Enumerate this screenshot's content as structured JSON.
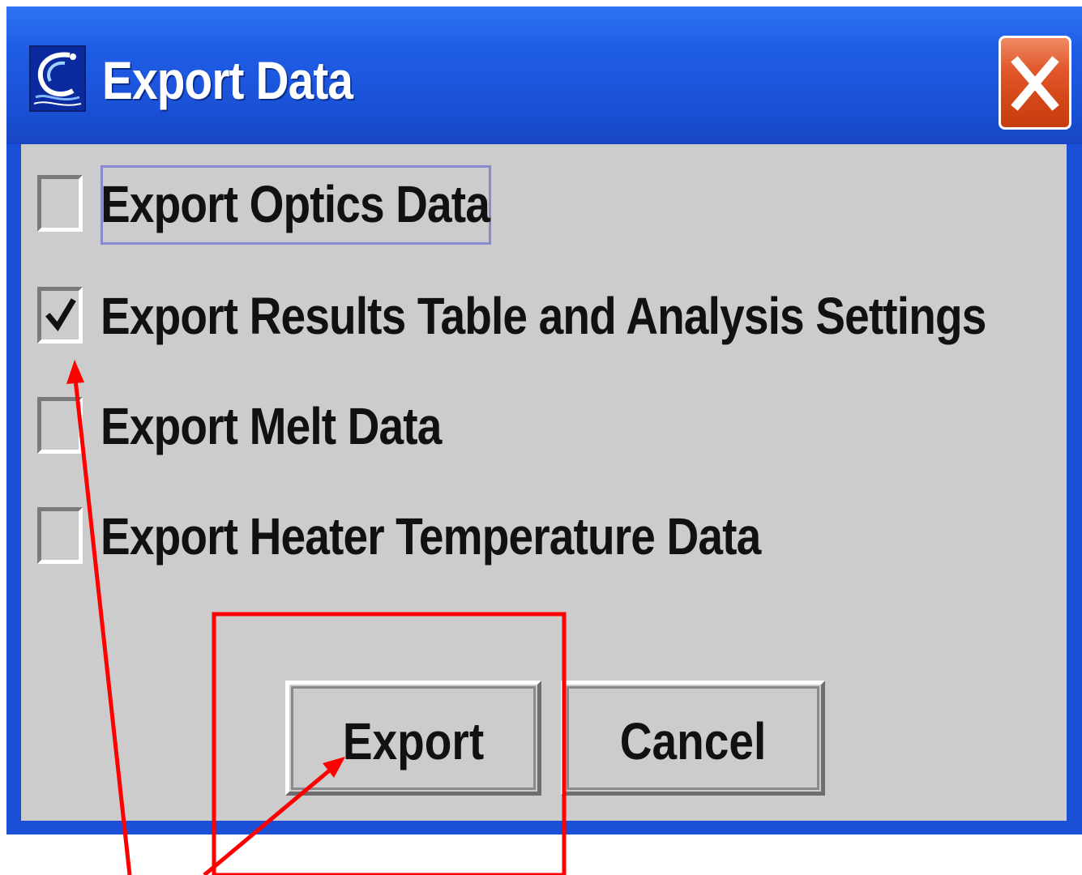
{
  "window": {
    "title": "Export Data"
  },
  "options": [
    {
      "label": "Export Optics Data",
      "checked": false,
      "focused": true
    },
    {
      "label": "Export Results Table and Analysis Settings",
      "checked": true,
      "focused": false
    },
    {
      "label": "Export Melt Data",
      "checked": false,
      "focused": false
    },
    {
      "label": "Export Heater Temperature Data",
      "checked": false,
      "focused": false
    }
  ],
  "buttons": {
    "export_label": "Export",
    "cancel_label": "Cancel"
  },
  "colors": {
    "titlebar": "#1f5de6",
    "client": "#cccccc",
    "close_button": "#d24716",
    "annotation": "#ff0000"
  },
  "icons": {
    "app": "app-logo-icon",
    "close": "close-x-icon",
    "check": "check-mark-icon"
  }
}
